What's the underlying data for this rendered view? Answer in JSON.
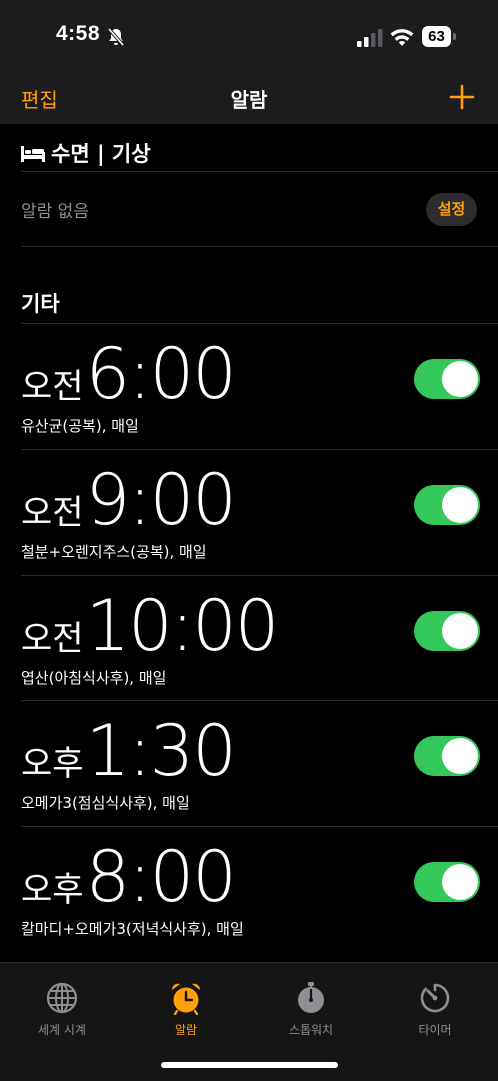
{
  "status_bar": {
    "time": "4:58",
    "battery": "63",
    "icons": [
      "bell-slash-icon",
      "signal-icon",
      "wifi-icon",
      "battery-icon"
    ]
  },
  "nav": {
    "edit_label": "편집",
    "title": "알람",
    "add_icon": "plus-icon"
  },
  "sleep": {
    "header": "수면 | 기상",
    "icon": "bed-icon",
    "empty_text": "알람 없음",
    "setup_label": "설정"
  },
  "other": {
    "header": "기타"
  },
  "alarms": [
    {
      "ampm": "오전",
      "time": "6:00",
      "label": "유산균(공복), 매일",
      "enabled": true
    },
    {
      "ampm": "오전",
      "time": "9:00",
      "label": "철분+오렌지주스(공복), 매일",
      "enabled": true
    },
    {
      "ampm": "오전",
      "time": "10:00",
      "label": "엽산(아침식사후), 매일",
      "enabled": true
    },
    {
      "ampm": "오후",
      "time": "1:30",
      "label": "오메가3(점심식사후), 매일",
      "enabled": true
    },
    {
      "ampm": "오후",
      "time": "8:00",
      "label": "칼마디+오메가3(저녁식사후), 매일",
      "enabled": true
    }
  ],
  "tabs": [
    {
      "label": "세계 시계",
      "icon": "globe-icon",
      "active": false
    },
    {
      "label": "알람",
      "icon": "alarm-clock-icon",
      "active": true
    },
    {
      "label": "스톱워치",
      "icon": "stopwatch-icon",
      "active": false
    },
    {
      "label": "타이머",
      "icon": "timer-icon",
      "active": false
    }
  ],
  "colors": {
    "accent": "#ff9f0a",
    "toggle_on": "#34c759",
    "background": "#000000",
    "bar_background": "#1c1c1e"
  }
}
